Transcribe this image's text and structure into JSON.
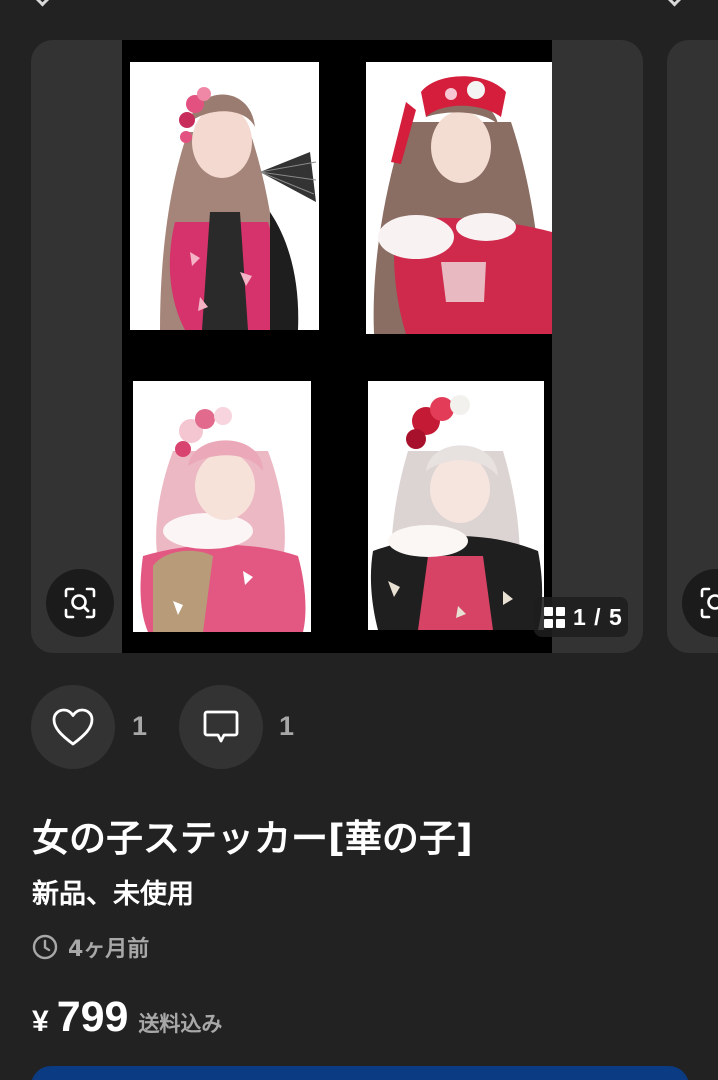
{
  "item": {
    "title": "女の子ステッカー[華の子]",
    "condition": "新品、未使用",
    "posted": "4ヶ月前",
    "price": {
      "currency": "¥",
      "amount": "799",
      "shipping": "送料込み"
    }
  },
  "gallery": {
    "counter": "1 / 5",
    "current": 1,
    "total": 5,
    "zoom_icon": "image-search-icon",
    "counter_icon": "grid-icon"
  },
  "actions": {
    "likes": {
      "icon": "heart-icon",
      "count": "1"
    },
    "comments": {
      "icon": "comment-icon",
      "count": "1"
    }
  },
  "colors": {
    "background": "#222222",
    "card": "#333333",
    "muted_text": "#a8a8a8",
    "accent_blue": "#0b3b82"
  }
}
